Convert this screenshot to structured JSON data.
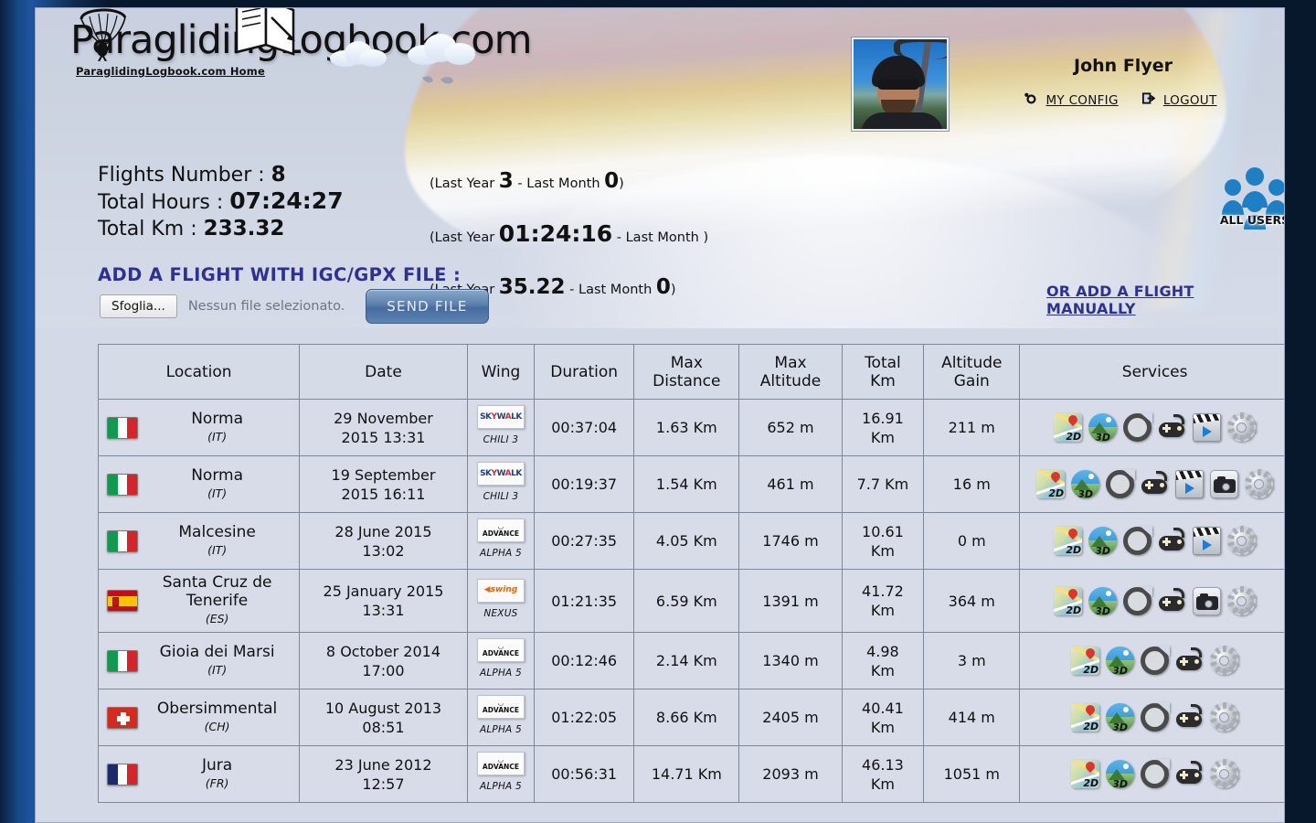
{
  "site": {
    "logo_text": "ParaglidingLogbook.com",
    "home_link": "ParaglidingLogbook.com Home"
  },
  "user": {
    "name": "John Flyer",
    "my_config": "MY CONFIG",
    "logout": "LOGOUT"
  },
  "all_users": {
    "label": "ALL USERS"
  },
  "stats": {
    "flights_label": "Flights Number :",
    "flights_value": "8",
    "flights_paren": "(Last Year 3 - Last Month 0)",
    "flights_paren_parts": {
      "pre": "(Last Year ",
      "ly": "3",
      "mid": " - Last Month ",
      "lm": "0",
      "post": ")"
    },
    "hours_label": "Total Hours :",
    "hours_value": "07:24:27",
    "hours_paren_parts": {
      "pre": "(Last Year ",
      "ly": "01:24:16",
      "mid": " - Last Month ",
      "lm": "",
      "post": ")"
    },
    "km_label": "Total Km :",
    "km_value": "233.32",
    "km_paren_parts": {
      "pre": "(Last Year ",
      "ly": "35.22",
      "mid": " - Last Month ",
      "lm": "0",
      "post": ")"
    }
  },
  "upload": {
    "title": "ADD A FLIGHT WITH IGC/GPX FILE :",
    "browse_label": "Sfoglia...",
    "no_file_text": "Nessun file selezionato.",
    "send_label": "SEND FILE",
    "manual_link": "OR ADD A FLIGHT MANUALLY"
  },
  "table": {
    "headers": [
      "Location",
      "Date",
      "Wing",
      "Duration",
      "Max\nDistance",
      "Max\nAltitude",
      "Total\nKm",
      "Altitude\nGain",
      "Services"
    ],
    "headers_flat": {
      "location": "Location",
      "date": "Date",
      "wing": "Wing",
      "duration": "Duration",
      "max_distance_l1": "Max",
      "max_distance_l2": "Distance",
      "max_altitude_l1": "Max",
      "max_altitude_l2": "Altitude",
      "total_km_l1": "Total",
      "total_km_l2": "Km",
      "altitude_gain_l1": "Altitude",
      "altitude_gain_l2": "Gain",
      "services": "Services"
    },
    "rows": [
      {
        "flag": "IT",
        "location": "Norma",
        "country": "(IT)",
        "date": "29 November 2015 13:31",
        "date_l1": "29 November",
        "date_l2": "2015 13:31",
        "wing_brand": "SKYWALK",
        "wing_model": "CHILI 3",
        "duration": "00:37:04",
        "max_distance": "1.63 Km",
        "max_altitude": "652 m",
        "total_km": "16.91 Km",
        "total_km_l1": "16.91",
        "total_km_l2": "Km",
        "altitude_gain": "211 m",
        "services": [
          "2d-map-icon",
          "3d-map-icon",
          "replay-icon",
          "game-icon",
          "video-icon",
          "gear-icon"
        ]
      },
      {
        "flag": "IT",
        "location": "Norma",
        "country": "(IT)",
        "date": "19 September 2015 16:11",
        "date_l1": "19 September",
        "date_l2": "2015 16:11",
        "wing_brand": "SKYWALK",
        "wing_model": "CHILI 3",
        "duration": "00:19:37",
        "max_distance": "1.54 Km",
        "max_altitude": "461 m",
        "total_km": "7.7 Km",
        "total_km_l1": "7.7 Km",
        "total_km_l2": "",
        "altitude_gain": "16 m",
        "services": [
          "2d-map-icon",
          "3d-map-icon",
          "replay-icon",
          "game-icon",
          "video-icon",
          "camera-icon",
          "gear-icon"
        ]
      },
      {
        "flag": "IT",
        "location": "Malcesine",
        "country": "(IT)",
        "date": "28 June 2015 13:02",
        "date_l1": "28 June 2015",
        "date_l2": "13:02",
        "wing_brand": "ADVANCE",
        "wing_model": "ALPHA 5",
        "duration": "00:27:35",
        "max_distance": "4.05 Km",
        "max_altitude": "1746 m",
        "total_km": "10.61 Km",
        "total_km_l1": "10.61",
        "total_km_l2": "Km",
        "altitude_gain": "0 m",
        "services": [
          "2d-map-icon",
          "3d-map-icon",
          "replay-icon",
          "game-icon",
          "video-icon",
          "gear-icon"
        ]
      },
      {
        "flag": "ES",
        "location": "Santa Cruz de Tenerife",
        "country": "(ES)",
        "date": "25 January 2015 13:31",
        "date_l1": "25 January 2015",
        "date_l2": "13:31",
        "wing_brand": "SWING",
        "wing_model": "NEXUS",
        "duration": "01:21:35",
        "max_distance": "6.59 Km",
        "max_altitude": "1391 m",
        "total_km": "41.72 Km",
        "total_km_l1": "41.72",
        "total_km_l2": "Km",
        "altitude_gain": "364 m",
        "services": [
          "2d-map-icon",
          "3d-map-icon",
          "replay-icon",
          "game-icon",
          "camera-icon",
          "gear-icon"
        ]
      },
      {
        "flag": "IT",
        "location": "Gioia dei Marsi",
        "country": "(IT)",
        "date": "8 October 2014 17:00",
        "date_l1": "8 October 2014",
        "date_l2": "17:00",
        "wing_brand": "ADVANCE",
        "wing_model": "ALPHA 5",
        "duration": "00:12:46",
        "max_distance": "2.14 Km",
        "max_altitude": "1340 m",
        "total_km": "4.98 Km",
        "total_km_l1": "4.98",
        "total_km_l2": "Km",
        "altitude_gain": "3 m",
        "services": [
          "2d-map-icon",
          "3d-map-icon",
          "replay-icon",
          "game-icon",
          "gear-icon"
        ]
      },
      {
        "flag": "CH",
        "location": "Obersimmental",
        "country": "(CH)",
        "date": "10 August 2013 08:51",
        "date_l1": "10 August 2013",
        "date_l2": "08:51",
        "wing_brand": "ADVANCE",
        "wing_model": "ALPHA 5",
        "duration": "01:22:05",
        "max_distance": "8.66 Km",
        "max_altitude": "2405 m",
        "total_km": "40.41 Km",
        "total_km_l1": "40.41",
        "total_km_l2": "Km",
        "altitude_gain": "414 m",
        "services": [
          "2d-map-icon",
          "3d-map-icon",
          "replay-icon",
          "game-icon",
          "gear-icon"
        ]
      },
      {
        "flag": "FR",
        "location": "Jura",
        "country": "(FR)",
        "date": "23 June 2012 12:57",
        "date_l1": "23 June 2012",
        "date_l2": "12:57",
        "wing_brand": "ADVANCE",
        "wing_model": "ALPHA 5",
        "duration": "00:56:31",
        "max_distance": "14.71 Km",
        "max_altitude": "2093 m",
        "total_km": "46.13 Km",
        "total_km_l1": "46.13",
        "total_km_l2": "Km",
        "altitude_gain": "1051 m",
        "services": [
          "2d-map-icon",
          "3d-map-icon",
          "replay-icon",
          "game-icon",
          "gear-icon"
        ]
      }
    ]
  },
  "colors": {
    "accent_blue": "#2d3192",
    "page_bg": "#d3d9e6",
    "frame_blue": "#16457f",
    "table_border": "#7d8798"
  }
}
